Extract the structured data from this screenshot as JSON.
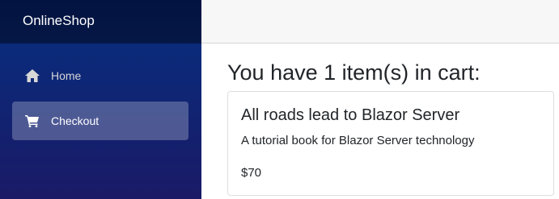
{
  "sidebar": {
    "brand": "OnlineShop",
    "items": [
      {
        "label": "Home",
        "icon": "home-icon",
        "active": false
      },
      {
        "label": "Checkout",
        "icon": "cart-icon",
        "active": true
      }
    ]
  },
  "main": {
    "heading": "You have 1 item(s) in cart:",
    "cart_items": [
      {
        "title": "All roads lead to Blazor Server",
        "description": "A tutorial book for Blazor Server technology",
        "price": "$70"
      }
    ]
  },
  "colors": {
    "sidebar_top": "#062270",
    "sidebar_bottom": "#1a1a66",
    "top_row": "#f7f7f7"
  }
}
